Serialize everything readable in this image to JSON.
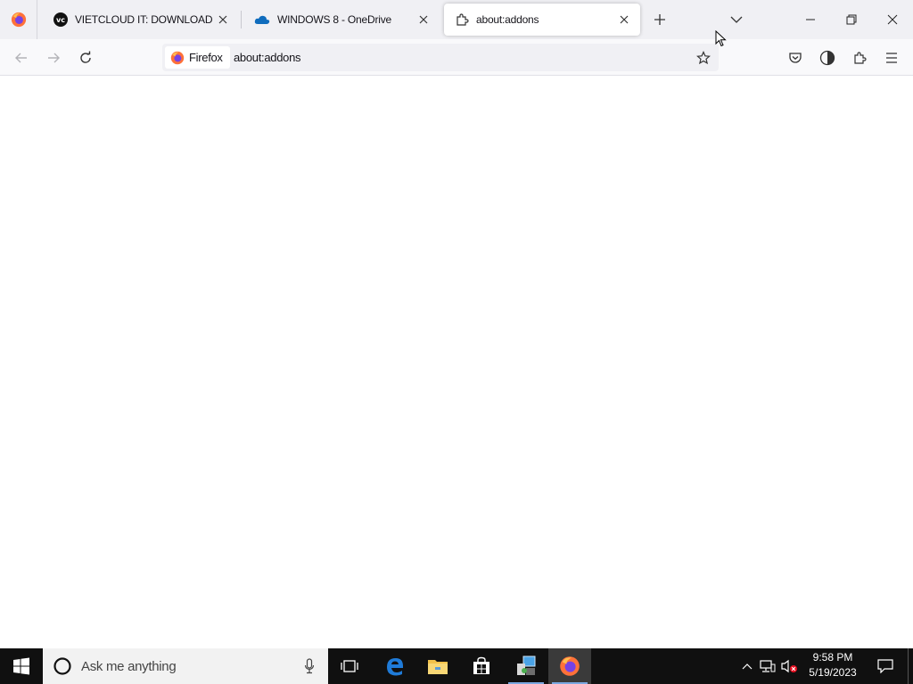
{
  "browser": {
    "tabs": [
      {
        "title": "VIETCLOUD IT: DOWNLOAD",
        "favicon": "vietcloud-icon",
        "active": false
      },
      {
        "title": "WINDOWS 8 - OneDrive",
        "favicon": "onedrive-cloud-icon",
        "active": false
      },
      {
        "title": "about:addons",
        "favicon": "puzzle-piece-icon",
        "active": true
      }
    ],
    "urlbar": {
      "identity_label": "Firefox",
      "url": "about:addons"
    }
  },
  "taskbar": {
    "search_placeholder": "Ask me anything",
    "clock_time": "9:58 PM",
    "clock_date": "5/19/2023"
  },
  "colors": {
    "tabstrip_bg": "#f0f0f4",
    "taskbar_bg": "#101010",
    "firefox_orange": "#ff7139",
    "edge_blue": "#1f7bd8"
  }
}
